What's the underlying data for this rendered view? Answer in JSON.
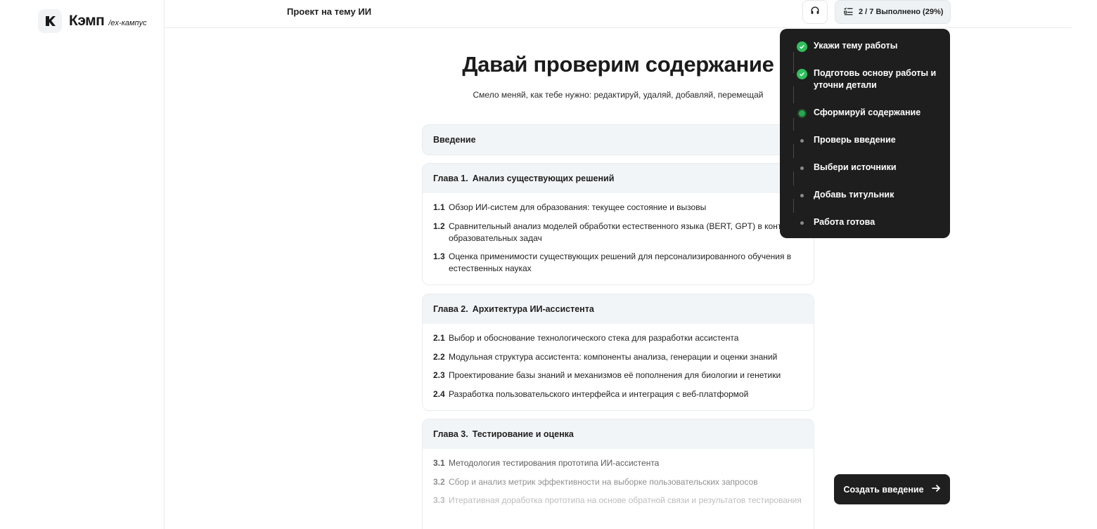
{
  "brand": {
    "name": "Кэмп",
    "sub": "/ex-кампус"
  },
  "header": {
    "project_title": "Проект на тему ИИ",
    "progress_label": "2 / 7 Выполнено (29%)"
  },
  "main": {
    "title": "Давай проверим содержание",
    "subtitle": "Смело меняй, как тебе нужно: редактируй, удаляй, добавляй, перемещай",
    "intro": "Введение",
    "chapters": [
      {
        "num": "Глава 1.",
        "title": "Анализ существующих решений",
        "items": [
          {
            "num": "1.1",
            "text": "Обзор ИИ-систем для образования: текущее состояние и вызовы"
          },
          {
            "num": "1.2",
            "text": "Сравнительный анализ моделей обработки естественного языка (BERT, GPT) в контексте образовательных задач"
          },
          {
            "num": "1.3",
            "text": "Оценка применимости существующих решений для персонализированного обучения в естественных науках"
          }
        ]
      },
      {
        "num": "Глава 2.",
        "title": "Архитектура ИИ-ассистента",
        "items": [
          {
            "num": "2.1",
            "text": "Выбор и обоснование технологического стека для разработки ассистента"
          },
          {
            "num": "2.2",
            "text": "Модульная структура ассистента: компоненты анализа, генерации и оценки знаний"
          },
          {
            "num": "2.3",
            "text": "Проектирование базы знаний и механизмов её пополнения для биологии и генетики"
          },
          {
            "num": "2.4",
            "text": "Разработка пользовательского интерфейса и интеграция с веб-платформой"
          }
        ]
      },
      {
        "num": "Глава 3.",
        "title": "Тестирование и оценка",
        "items": [
          {
            "num": "3.1",
            "text": "Методология тестирования прототипа ИИ-ассистента"
          },
          {
            "num": "3.2",
            "text": "Сбор и анализ метрик эффективности на выборке пользовательских запросов"
          },
          {
            "num": "3.3",
            "text": "Итеративная доработка прототипа на основе обратной связи и результатов тестирования"
          }
        ]
      }
    ]
  },
  "steps": [
    {
      "label": "Укажи тему работы",
      "status": "done"
    },
    {
      "label": "Подготовь основу работы и уточни детали",
      "status": "done"
    },
    {
      "label": "Сформируй содержание",
      "status": "active"
    },
    {
      "label": "Проверь введение",
      "status": "pending"
    },
    {
      "label": "Выбери источники",
      "status": "pending"
    },
    {
      "label": "Добавь титульник",
      "status": "pending"
    },
    {
      "label": "Работа готова",
      "status": "pending"
    }
  ],
  "cta": {
    "label": "Создать введение"
  },
  "icons": {
    "headset": "headset-icon",
    "progress": "checklist-icon",
    "cta_arrow": "arrow-right-icon",
    "step_done": "check-icon"
  },
  "colors": {
    "accent_green": "#2fbf5c",
    "dark": "#1e1e1e",
    "card_head": "#f2f5f8"
  }
}
